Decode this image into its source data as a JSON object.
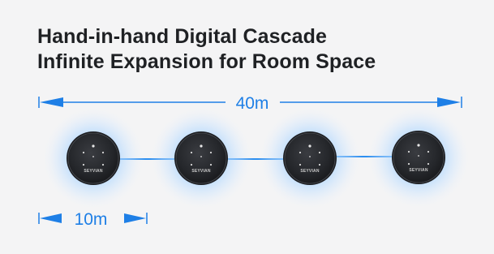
{
  "headline": {
    "line1": "Hand-in-hand Digital Cascade",
    "line2": "Infinite Expansion for Room Space"
  },
  "dimension_total": {
    "label": "40m"
  },
  "dimension_unit": {
    "label": "10m"
  },
  "devices": [
    {
      "brand": "SEYVIAN"
    },
    {
      "brand": "SEYVIAN"
    },
    {
      "brand": "SEYVIAN"
    },
    {
      "brand": "SEYVIAN"
    }
  ],
  "colors": {
    "accent": "#1e7fe6",
    "glow": "#8cc6ff",
    "device_body": "#2b2d31",
    "headline": "#1f2124",
    "background": "#f4f4f5"
  },
  "icons": [
    "arrow-left-icon",
    "arrow-right-icon",
    "speaker-device-icon",
    "link-cable-icon"
  ]
}
